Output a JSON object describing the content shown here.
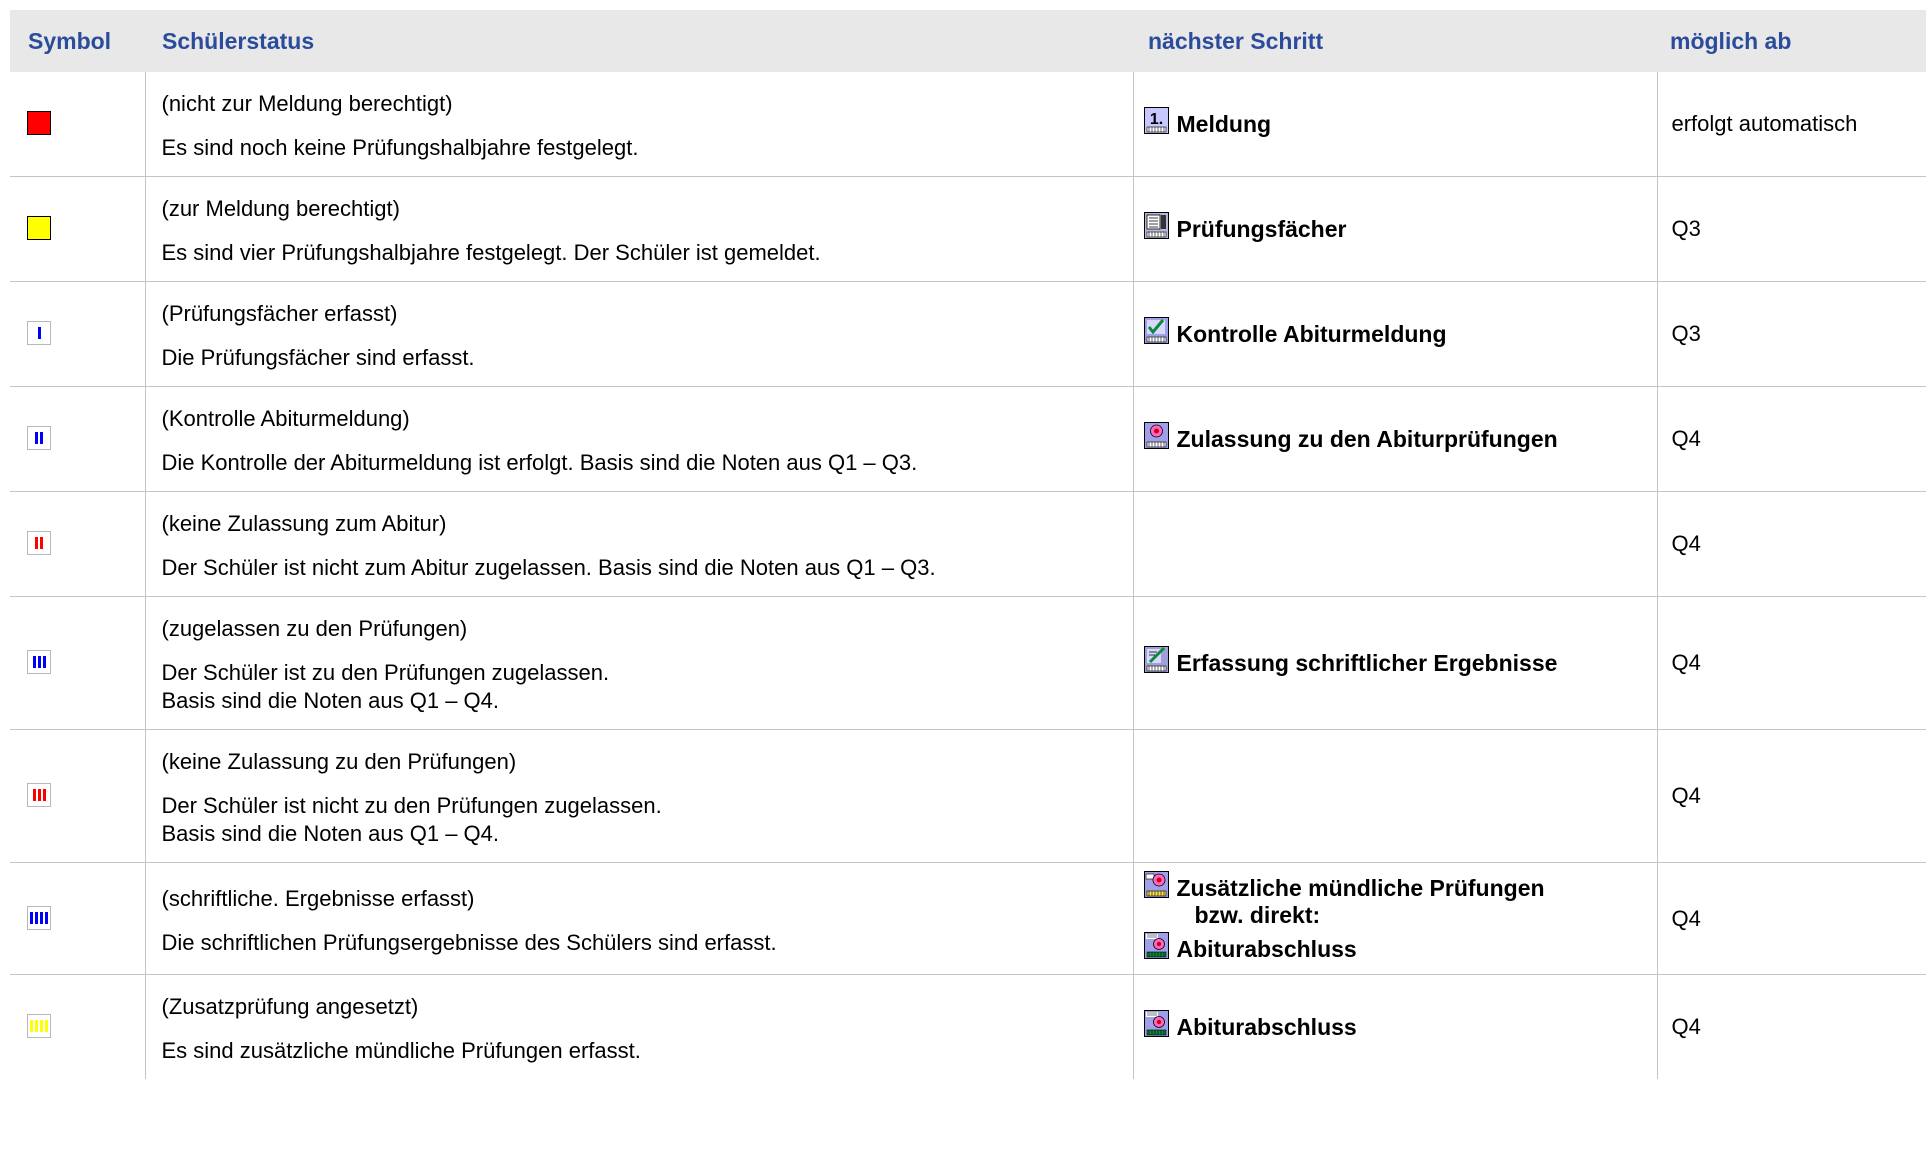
{
  "headers": {
    "symbol": "Symbol",
    "status": "Schülerstatus",
    "next": "nächster Schritt",
    "ab": "möglich ab"
  },
  "rows": [
    {
      "symbol": {
        "type": "solid",
        "color": "#ff0000"
      },
      "status_title": "(nicht zur Meldung berechtigt)",
      "status_desc": "Es sind noch keine Prüfungshalbjahre festgelegt.",
      "next": [
        {
          "icon": "meldung-icon",
          "label": "Meldung"
        }
      ],
      "ab": "erfolgt automatisch"
    },
    {
      "symbol": {
        "type": "solid",
        "color": "#ffff00"
      },
      "status_title": "(zur Meldung berechtigt)",
      "status_desc": "Es sind vier Prüfungshalbjahre festgelegt. Der Schüler ist gemeldet.",
      "next": [
        {
          "icon": "pruefungsfaecher-icon",
          "label": "Prüfungsfächer"
        }
      ],
      "ab": "Q3"
    },
    {
      "symbol": {
        "type": "bars",
        "count": 1,
        "color": "#0000ff"
      },
      "status_title": "(Prüfungsfächer erfasst)",
      "status_desc": "Die Prüfungsfächer sind erfasst.",
      "next": [
        {
          "icon": "kontrolle-icon",
          "label": "Kontrolle Abiturmeldung"
        }
      ],
      "ab": "Q3"
    },
    {
      "symbol": {
        "type": "bars",
        "count": 2,
        "color": "#0000ff"
      },
      "status_title": "(Kontrolle Abiturmeldung)",
      "status_desc": "Die Kontrolle der Abiturmeldung ist erfolgt. Basis sind die Noten aus Q1 – Q3.",
      "next": [
        {
          "icon": "zulassung-icon",
          "label": "Zulassung zu den Abiturprüfungen"
        }
      ],
      "ab": "Q4"
    },
    {
      "symbol": {
        "type": "bars",
        "count": 2,
        "color": "#ff0000"
      },
      "status_title": "(keine Zulassung zum Abitur)",
      "status_desc": "Der Schüler ist nicht zum Abitur zugelassen. Basis sind die Noten aus Q1 – Q3.",
      "next": [],
      "ab": "Q4"
    },
    {
      "symbol": {
        "type": "bars",
        "count": 3,
        "color": "#0000ff"
      },
      "status_title": "(zugelassen zu den Prüfungen)",
      "status_desc": "Der Schüler ist zu den Prüfungen zugelassen.",
      "status_desc2": "Basis sind die Noten aus Q1 – Q4.",
      "next": [
        {
          "icon": "erfassung-icon",
          "label": "Erfassung schriftlicher Ergebnisse"
        }
      ],
      "ab": "Q4"
    },
    {
      "symbol": {
        "type": "bars",
        "count": 3,
        "color": "#ff0000"
      },
      "status_title": "(keine Zulassung zu den Prüfungen)",
      "status_desc": "Der Schüler ist nicht zu den Prüfungen zugelassen.",
      "status_desc2": "Basis sind die Noten aus Q1 – Q4.",
      "next": [],
      "ab": "Q4"
    },
    {
      "symbol": {
        "type": "bars",
        "count": 4,
        "color": "#0000ff"
      },
      "status_title": "(schriftliche. Ergebnisse erfasst)",
      "status_desc": "Die schriftlichen Prüfungsergebnisse des Schülers sind erfasst.",
      "next": [
        {
          "icon": "muendlich-icon",
          "label": "Zusätzliche mündliche Prüfungen"
        },
        {
          "sub": "bzw. direkt:"
        },
        {
          "icon": "abiturabschluss-icon",
          "label": "Abiturabschluss"
        }
      ],
      "ab": "Q4"
    },
    {
      "symbol": {
        "type": "bars",
        "count": 4,
        "color": "#ffff00"
      },
      "status_title": "(Zusatzprüfung angesetzt)",
      "status_desc": "Es sind zusätzliche mündliche Prüfungen erfasst.",
      "next": [
        {
          "icon": "abiturabschluss-icon",
          "label": "Abiturabschluss"
        }
      ],
      "ab": "Q4"
    }
  ]
}
